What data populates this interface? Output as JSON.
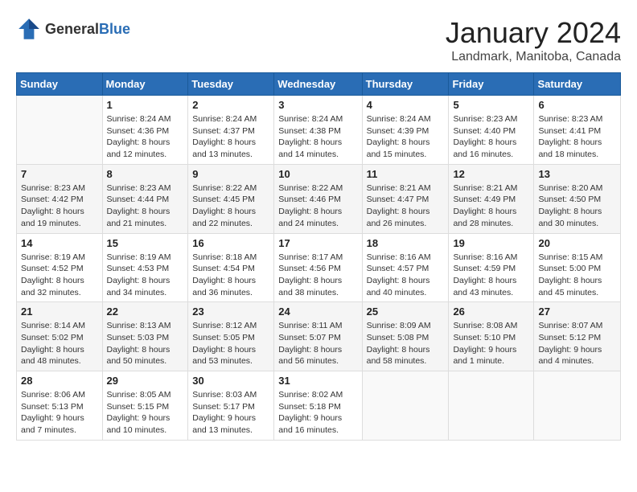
{
  "header": {
    "logo_general": "General",
    "logo_blue": "Blue",
    "month_title": "January 2024",
    "location": "Landmark, Manitoba, Canada"
  },
  "days_of_week": [
    "Sunday",
    "Monday",
    "Tuesday",
    "Wednesday",
    "Thursday",
    "Friday",
    "Saturday"
  ],
  "weeks": [
    [
      {
        "day": "",
        "info": ""
      },
      {
        "day": "1",
        "info": "Sunrise: 8:24 AM\nSunset: 4:36 PM\nDaylight: 8 hours\nand 12 minutes."
      },
      {
        "day": "2",
        "info": "Sunrise: 8:24 AM\nSunset: 4:37 PM\nDaylight: 8 hours\nand 13 minutes."
      },
      {
        "day": "3",
        "info": "Sunrise: 8:24 AM\nSunset: 4:38 PM\nDaylight: 8 hours\nand 14 minutes."
      },
      {
        "day": "4",
        "info": "Sunrise: 8:24 AM\nSunset: 4:39 PM\nDaylight: 8 hours\nand 15 minutes."
      },
      {
        "day": "5",
        "info": "Sunrise: 8:23 AM\nSunset: 4:40 PM\nDaylight: 8 hours\nand 16 minutes."
      },
      {
        "day": "6",
        "info": "Sunrise: 8:23 AM\nSunset: 4:41 PM\nDaylight: 8 hours\nand 18 minutes."
      }
    ],
    [
      {
        "day": "7",
        "info": "Sunrise: 8:23 AM\nSunset: 4:42 PM\nDaylight: 8 hours\nand 19 minutes."
      },
      {
        "day": "8",
        "info": "Sunrise: 8:23 AM\nSunset: 4:44 PM\nDaylight: 8 hours\nand 21 minutes."
      },
      {
        "day": "9",
        "info": "Sunrise: 8:22 AM\nSunset: 4:45 PM\nDaylight: 8 hours\nand 22 minutes."
      },
      {
        "day": "10",
        "info": "Sunrise: 8:22 AM\nSunset: 4:46 PM\nDaylight: 8 hours\nand 24 minutes."
      },
      {
        "day": "11",
        "info": "Sunrise: 8:21 AM\nSunset: 4:47 PM\nDaylight: 8 hours\nand 26 minutes."
      },
      {
        "day": "12",
        "info": "Sunrise: 8:21 AM\nSunset: 4:49 PM\nDaylight: 8 hours\nand 28 minutes."
      },
      {
        "day": "13",
        "info": "Sunrise: 8:20 AM\nSunset: 4:50 PM\nDaylight: 8 hours\nand 30 minutes."
      }
    ],
    [
      {
        "day": "14",
        "info": "Sunrise: 8:19 AM\nSunset: 4:52 PM\nDaylight: 8 hours\nand 32 minutes."
      },
      {
        "day": "15",
        "info": "Sunrise: 8:19 AM\nSunset: 4:53 PM\nDaylight: 8 hours\nand 34 minutes."
      },
      {
        "day": "16",
        "info": "Sunrise: 8:18 AM\nSunset: 4:54 PM\nDaylight: 8 hours\nand 36 minutes."
      },
      {
        "day": "17",
        "info": "Sunrise: 8:17 AM\nSunset: 4:56 PM\nDaylight: 8 hours\nand 38 minutes."
      },
      {
        "day": "18",
        "info": "Sunrise: 8:16 AM\nSunset: 4:57 PM\nDaylight: 8 hours\nand 40 minutes."
      },
      {
        "day": "19",
        "info": "Sunrise: 8:16 AM\nSunset: 4:59 PM\nDaylight: 8 hours\nand 43 minutes."
      },
      {
        "day": "20",
        "info": "Sunrise: 8:15 AM\nSunset: 5:00 PM\nDaylight: 8 hours\nand 45 minutes."
      }
    ],
    [
      {
        "day": "21",
        "info": "Sunrise: 8:14 AM\nSunset: 5:02 PM\nDaylight: 8 hours\nand 48 minutes."
      },
      {
        "day": "22",
        "info": "Sunrise: 8:13 AM\nSunset: 5:03 PM\nDaylight: 8 hours\nand 50 minutes."
      },
      {
        "day": "23",
        "info": "Sunrise: 8:12 AM\nSunset: 5:05 PM\nDaylight: 8 hours\nand 53 minutes."
      },
      {
        "day": "24",
        "info": "Sunrise: 8:11 AM\nSunset: 5:07 PM\nDaylight: 8 hours\nand 56 minutes."
      },
      {
        "day": "25",
        "info": "Sunrise: 8:09 AM\nSunset: 5:08 PM\nDaylight: 8 hours\nand 58 minutes."
      },
      {
        "day": "26",
        "info": "Sunrise: 8:08 AM\nSunset: 5:10 PM\nDaylight: 9 hours\nand 1 minute."
      },
      {
        "day": "27",
        "info": "Sunrise: 8:07 AM\nSunset: 5:12 PM\nDaylight: 9 hours\nand 4 minutes."
      }
    ],
    [
      {
        "day": "28",
        "info": "Sunrise: 8:06 AM\nSunset: 5:13 PM\nDaylight: 9 hours\nand 7 minutes."
      },
      {
        "day": "29",
        "info": "Sunrise: 8:05 AM\nSunset: 5:15 PM\nDaylight: 9 hours\nand 10 minutes."
      },
      {
        "day": "30",
        "info": "Sunrise: 8:03 AM\nSunset: 5:17 PM\nDaylight: 9 hours\nand 13 minutes."
      },
      {
        "day": "31",
        "info": "Sunrise: 8:02 AM\nSunset: 5:18 PM\nDaylight: 9 hours\nand 16 minutes."
      },
      {
        "day": "",
        "info": ""
      },
      {
        "day": "",
        "info": ""
      },
      {
        "day": "",
        "info": ""
      }
    ]
  ]
}
